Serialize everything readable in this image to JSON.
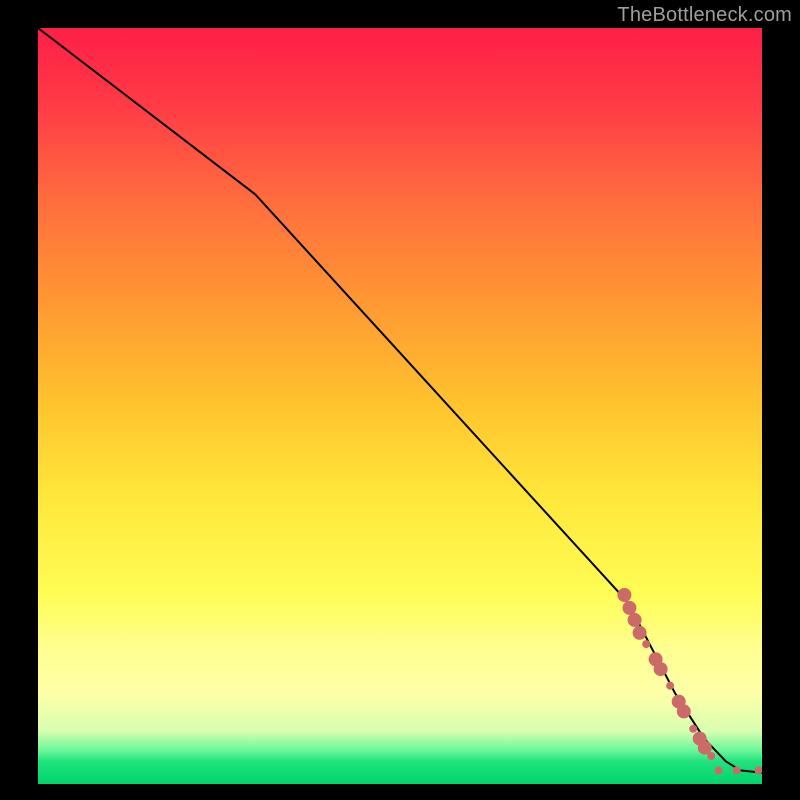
{
  "watermark": "TheBottleneck.com",
  "chart_data": {
    "type": "line",
    "title": "",
    "xlabel": "",
    "ylabel": "",
    "xlim": [
      0,
      100
    ],
    "ylim": [
      0,
      100
    ],
    "grid": false,
    "legend": false,
    "series": [
      {
        "name": "curve",
        "color": "#000000",
        "stroke_width": 2,
        "x": [
          0,
          30,
          81.5,
          88,
          92,
          95,
          97,
          100
        ],
        "y": [
          100,
          78,
          24,
          12,
          6,
          3,
          1.8,
          1.5
        ]
      }
    ],
    "markers": {
      "name": "highlight-dots",
      "color": "#cc6a6a",
      "radius_small": 4,
      "radius_large": 7,
      "points": [
        {
          "x": 81.0,
          "y": 25.0,
          "r": "large"
        },
        {
          "x": 81.7,
          "y": 23.3,
          "r": "large"
        },
        {
          "x": 82.4,
          "y": 21.7,
          "r": "large"
        },
        {
          "x": 83.1,
          "y": 20.0,
          "r": "large"
        },
        {
          "x": 84.0,
          "y": 18.5,
          "r": "small"
        },
        {
          "x": 85.3,
          "y": 16.5,
          "r": "large"
        },
        {
          "x": 86.0,
          "y": 15.2,
          "r": "large"
        },
        {
          "x": 87.3,
          "y": 13.0,
          "r": "small"
        },
        {
          "x": 88.5,
          "y": 10.9,
          "r": "large"
        },
        {
          "x": 89.2,
          "y": 9.6,
          "r": "large"
        },
        {
          "x": 90.5,
          "y": 7.3,
          "r": "small"
        },
        {
          "x": 91.4,
          "y": 6.0,
          "r": "large"
        },
        {
          "x": 92.1,
          "y": 4.8,
          "r": "large"
        },
        {
          "x": 93.0,
          "y": 3.7,
          "r": "small"
        },
        {
          "x": 94.0,
          "y": 1.8,
          "r": "small"
        },
        {
          "x": 96.5,
          "y": 1.8,
          "r": "small"
        },
        {
          "x": 99.5,
          "y": 1.8,
          "r": "small"
        }
      ]
    },
    "background_gradient": {
      "stops": [
        {
          "pct": 0,
          "color": "#ff1f47"
        },
        {
          "pct": 50,
          "color": "#ffc42e"
        },
        {
          "pct": 82,
          "color": "#ffff90"
        },
        {
          "pct": 97,
          "color": "#21e27e"
        },
        {
          "pct": 100,
          "color": "#00d46b"
        }
      ]
    }
  }
}
